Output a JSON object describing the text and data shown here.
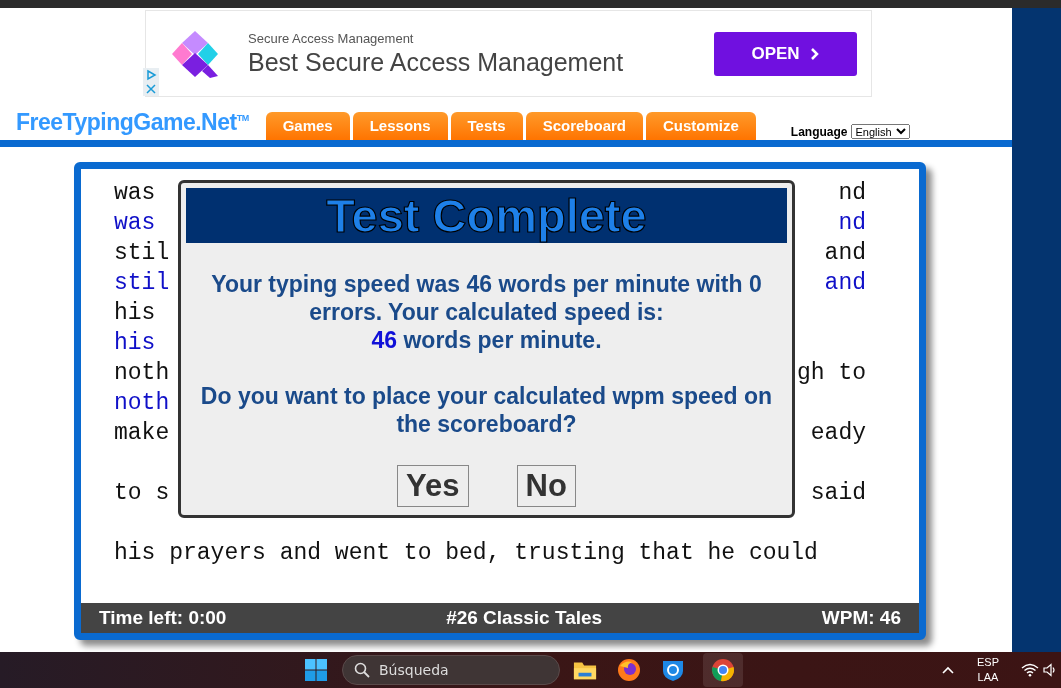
{
  "ad": {
    "subtitle": "Secure Access Management",
    "title": "Best Secure Access Management",
    "button": "OPEN"
  },
  "site": {
    "logo": "FreeTypingGame.Net",
    "trademark": "TM"
  },
  "nav": [
    {
      "label": "Games"
    },
    {
      "label": "Lessons"
    },
    {
      "label": "Tests"
    },
    {
      "label": "Scoreboard"
    },
    {
      "label": "Customize"
    }
  ],
  "language": {
    "label": "Language",
    "value": "English"
  },
  "game": {
    "lines": [
      {
        "kind": "source",
        "left": "was",
        "right": "nd"
      },
      {
        "kind": "typed",
        "left": "was",
        "right": "nd"
      },
      {
        "kind": "source",
        "left": "stil",
        "right": "and"
      },
      {
        "kind": "typed",
        "left": "stil",
        "right": "and"
      },
      {
        "kind": "source",
        "left": "his"
      },
      {
        "kind": "typed",
        "left": "his"
      },
      {
        "kind": "source",
        "left": "noth",
        "right": "gh to"
      },
      {
        "kind": "typed",
        "left": "noth"
      },
      {
        "kind": "source",
        "left": "make",
        "right": "eady"
      },
      {
        "kind": "blank"
      },
      {
        "kind": "source",
        "left": "to s",
        "right": "said"
      },
      {
        "kind": "blank"
      },
      {
        "kind": "source",
        "left": "his prayers and went to bed, trusting that he could"
      }
    ],
    "status": {
      "time_left": "Time left: 0:00",
      "title": "#26 Classic Tales",
      "wpm": "WPM: 46"
    }
  },
  "dialog": {
    "title": "Test Complete",
    "message": "Your typing speed was 46 words per minute with 0 errors. Your calculated speed is:",
    "speed": "46",
    "speed_unit": "words per minute.",
    "question": "Do you want to place your calculated wpm speed on the scoreboard?",
    "buttons": [
      "Yes",
      "No"
    ]
  },
  "taskbar": {
    "search_placeholder": "Búsqueda",
    "input_language": "ESP",
    "keyboard_layout": "LAA"
  }
}
